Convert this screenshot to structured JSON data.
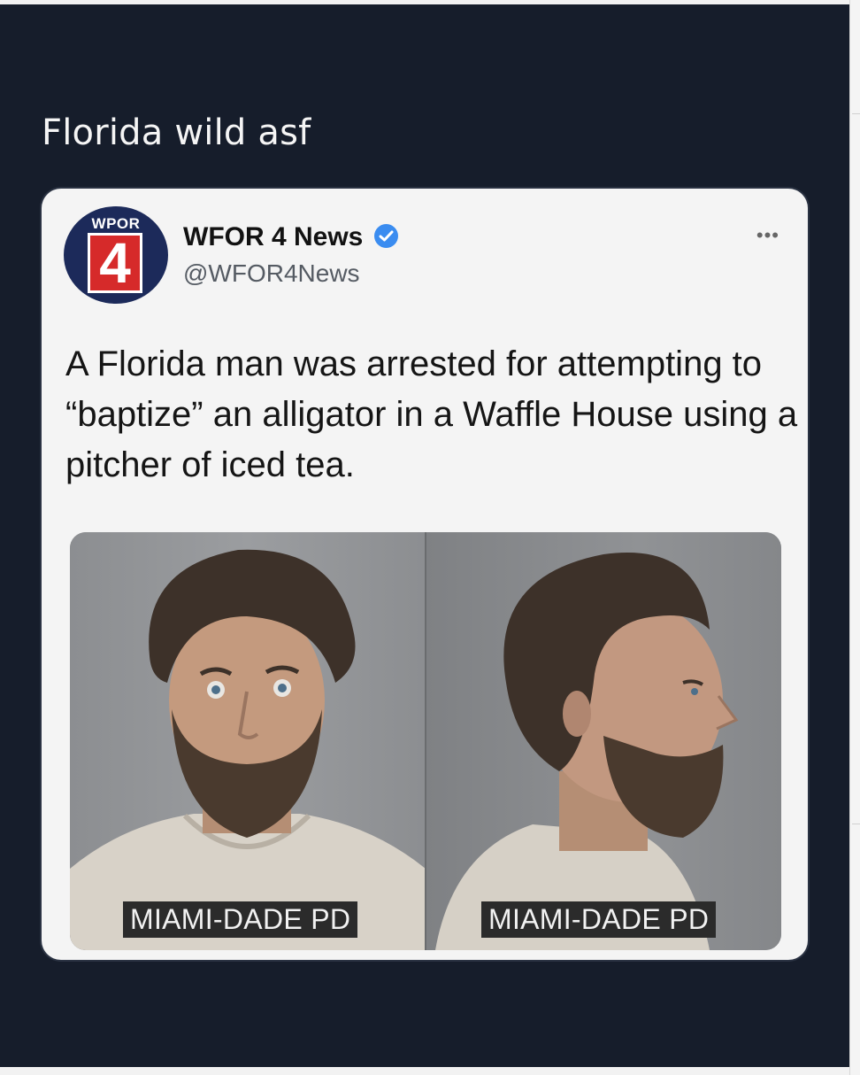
{
  "post": {
    "caption": "Florida wild asf"
  },
  "embedded_tweet": {
    "avatar": {
      "station_text": "WPOR",
      "channel_number": "4"
    },
    "account_name": "WFOR 4 News",
    "handle": "@WFOR4News",
    "more_label": "•••",
    "text": "A Florida man was arrested for attempting to “baptize” an alligator in a Waffle House using a pitcher of iced tea.",
    "media": {
      "left_label": "MIAMI-DADE PD",
      "right_label": "MIAMI-DADE PD"
    }
  },
  "colors": {
    "background": "#161d2b",
    "card": "#f4f4f4",
    "verified_badge": "#3a8cf0",
    "avatar_bg": "#1c2a5a",
    "avatar_red": "#d62a2a"
  },
  "icons": [
    "verified-badge-icon",
    "more-options-icon"
  ]
}
